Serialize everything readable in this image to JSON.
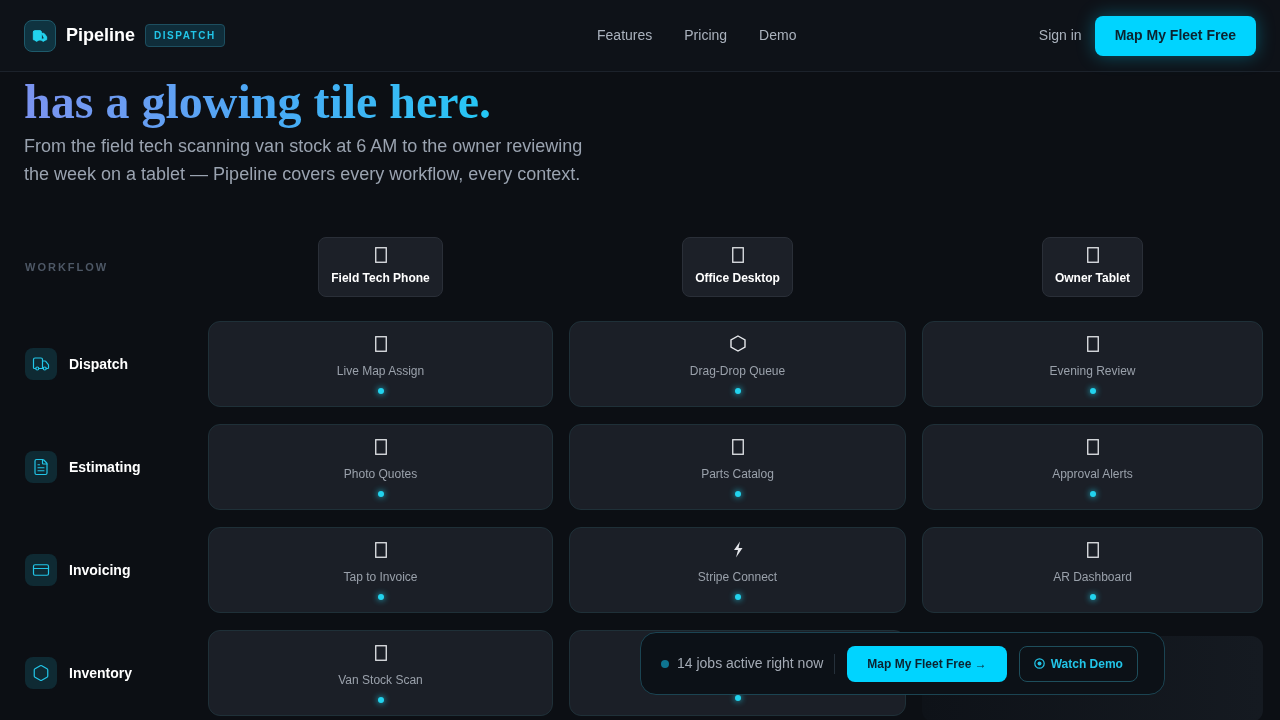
{
  "header": {
    "brand": "Pipeline",
    "badge": "DISPATCH",
    "nav": [
      "Features",
      "Pricing",
      "Demo"
    ],
    "sign_in": "Sign in",
    "cta": "Map My Fleet Free"
  },
  "hero": {
    "headline": "has a glowing tile here.",
    "subtitle": "From the field tech scanning van stock at 6 AM to the owner reviewing the week on a tablet — Pipeline covers every workflow, every context."
  },
  "matrix": {
    "corner": "WORKFLOW",
    "devices": [
      "Field Tech Phone",
      "Office Desktop",
      "Owner Tablet"
    ],
    "rows": [
      {
        "label": "Dispatch",
        "cells": [
          {
            "label": "Live Map Assign",
            "faded": false
          },
          {
            "label": "Drag-Drop Queue",
            "faded": false
          },
          {
            "label": "Evening Review",
            "faded": false
          }
        ]
      },
      {
        "label": "Estimating",
        "cells": [
          {
            "label": "Photo Quotes",
            "faded": false
          },
          {
            "label": "Parts Catalog",
            "faded": false
          },
          {
            "label": "Approval Alerts",
            "faded": false
          }
        ]
      },
      {
        "label": "Invoicing",
        "cells": [
          {
            "label": "Tap to Invoice",
            "faded": false
          },
          {
            "label": "Stripe Connect",
            "faded": false
          },
          {
            "label": "AR Dashboard",
            "faded": false
          }
        ]
      },
      {
        "label": "Inventory",
        "cells": [
          {
            "label": "Van Stock Scan",
            "faded": false
          },
          {
            "faded": false
          },
          {
            "faded": true
          }
        ]
      }
    ]
  },
  "floating_bar": {
    "status": "14 jobs active right now",
    "primary": "Map My Fleet Free →",
    "secondary": "Watch Demo"
  }
}
